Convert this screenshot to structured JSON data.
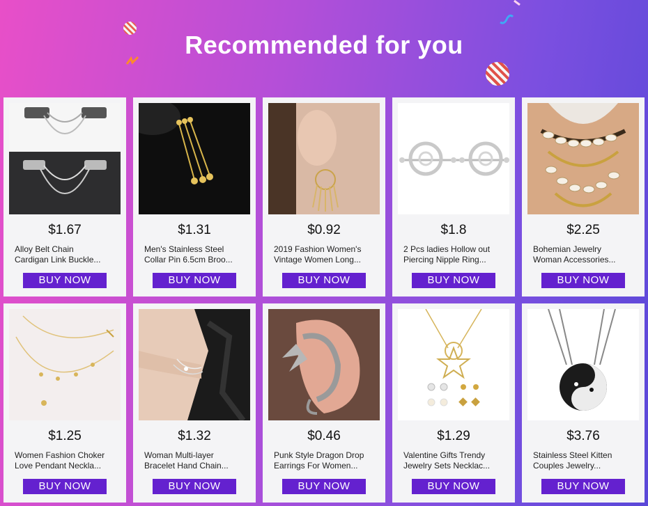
{
  "banner": {
    "title": "Recommended for you"
  },
  "colors": {
    "button": "#6421cf",
    "card": "#f4f4f6"
  },
  "products": [
    {
      "price": "$1.67",
      "line1": "Alloy Belt Chain",
      "line2": "Cardigan Link Buckle...",
      "button": "BUY NOW",
      "image": "chain-clip-image"
    },
    {
      "price": "$1.31",
      "line1": "Men's Stainless Steel",
      "line2": "Collar Pin 6.5cm Broo...",
      "button": "BUY NOW",
      "image": "collar-pin-image"
    },
    {
      "price": "$0.92",
      "line1": "2019 Fashion Women's",
      "line2": "Vintage Women Long...",
      "button": "BUY NOW",
      "image": "tassel-earring-image"
    },
    {
      "price": "$1.8",
      "line1": "2 Pcs ladies Hollow out",
      "line2": "Piercing Nipple Ring...",
      "button": "BUY NOW",
      "image": "hollow-ring-image"
    },
    {
      "price": "$2.25",
      "line1": "Bohemian Jewelry",
      "line2": "Woman Accessories...",
      "button": "BUY NOW",
      "image": "shell-necklace-image"
    },
    {
      "price": "$1.25",
      "line1": "Women Fashion Choker",
      "line2": "Love Pendant Neckla...",
      "button": "BUY NOW",
      "image": "choker-image"
    },
    {
      "price": "$1.32",
      "line1": "Woman Multi-layer",
      "line2": "Bracelet Hand Chain...",
      "button": "BUY NOW",
      "image": "bracelet-image"
    },
    {
      "price": "$0.46",
      "line1": "Punk Style Dragon Drop",
      "line2": "Earrings For Women...",
      "button": "BUY NOW",
      "image": "dragon-earcuff-image"
    },
    {
      "price": "$1.29",
      "line1": "Valentine Gifts Trendy",
      "line2": "Jewelry Sets Necklac...",
      "button": "BUY NOW",
      "image": "star-necklace-set-image"
    },
    {
      "price": "$3.76",
      "line1": "Stainless Steel Kitten",
      "line2": "Couples Jewelry...",
      "button": "BUY NOW",
      "image": "kitten-pendant-image"
    }
  ]
}
